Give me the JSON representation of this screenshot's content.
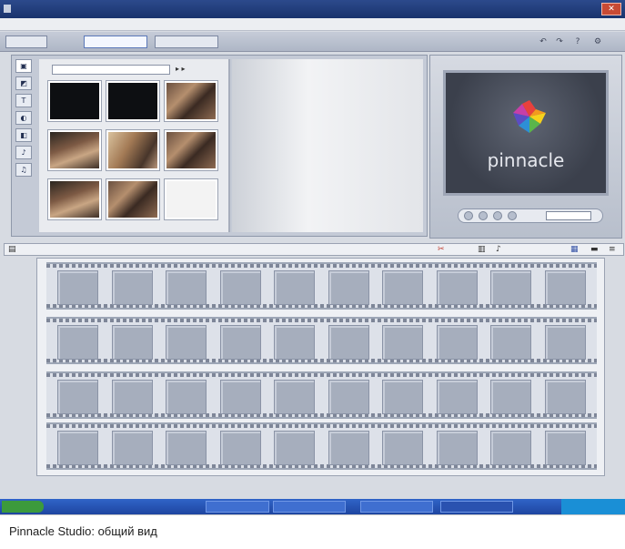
{
  "caption": "Pinnacle Studio: общий вид",
  "brand": "pinnacle",
  "chart_data": null
}
